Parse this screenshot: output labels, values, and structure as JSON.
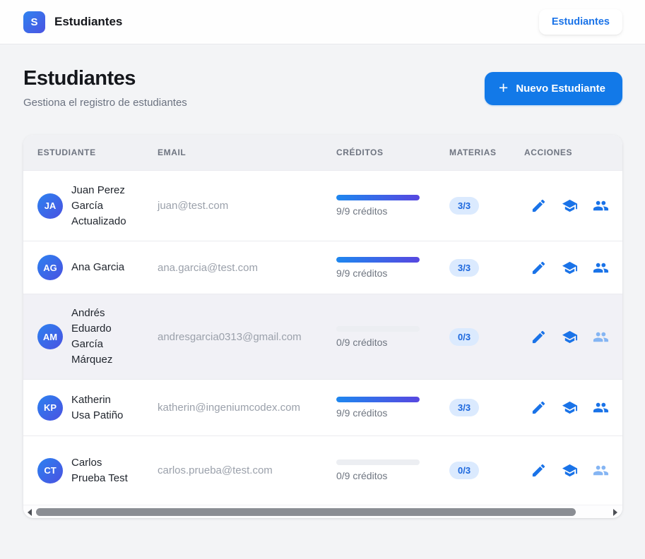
{
  "navbar": {
    "logo_letter": "S",
    "app_title": "Estudiantes",
    "nav_link": "Estudiantes"
  },
  "header": {
    "title": "Estudiantes",
    "subtitle": "Gestiona el registro de estudiantes",
    "new_student_button": "Nuevo Estudiante",
    "plus_glyph": "+"
  },
  "table": {
    "columns": {
      "student": "Estudiante",
      "email": "Email",
      "credits": "Créditos",
      "materias": "Materias",
      "actions": "Acciones"
    },
    "rows": [
      {
        "initials": "JA",
        "name": "Juan Perez García Actualizado",
        "email": "juan@test.com",
        "credits_text": "9/9 créditos",
        "credits_percent": 100,
        "materias_badge": "3/3",
        "highlighted": false,
        "group_icon_disabled": false
      },
      {
        "initials": "AG",
        "name": "Ana Garcia",
        "email": "ana.garcia@test.com",
        "credits_text": "9/9 créditos",
        "credits_percent": 100,
        "materias_badge": "3/3",
        "highlighted": false,
        "group_icon_disabled": false
      },
      {
        "initials": "AM",
        "name": "Andrés Eduardo García Márquez",
        "email": "andresgarcia0313@gmail.com",
        "credits_text": "0/9 créditos",
        "credits_percent": 0,
        "materias_badge": "0/3",
        "highlighted": true,
        "group_icon_disabled": true
      },
      {
        "initials": "KP",
        "name": "Katherin Usa Patiño",
        "email": "katherin@ingeniumcodex.com",
        "credits_text": "9/9 créditos",
        "credits_percent": 100,
        "materias_badge": "3/3",
        "highlighted": false,
        "group_icon_disabled": false
      },
      {
        "initials": "CT",
        "name": "Carlos Prueba Test",
        "email": "carlos.prueba@test.com",
        "credits_text": "0/9 créditos",
        "credits_percent": 0,
        "materias_badge": "0/3",
        "highlighted": false,
        "group_icon_disabled": true
      }
    ]
  },
  "icons": {
    "edit": "pencil",
    "subjects": "graduation-cap",
    "group": "two-people",
    "delete": "red-pill-button-clipped",
    "scroll_left": "left-triangle",
    "scroll_right": "right-triangle"
  },
  "colors": {
    "accent_blue": "#1a73e8",
    "button_blue": "#1279e8",
    "progress_start": "#1e87ef",
    "progress_end": "#5747e0",
    "badge_bg": "#dbeafe",
    "badge_text": "#1a66dd",
    "icon_disabled": "#85b5f3",
    "delete_bg": "#fbe7e7",
    "highlight_row": "#f1f1f6"
  }
}
